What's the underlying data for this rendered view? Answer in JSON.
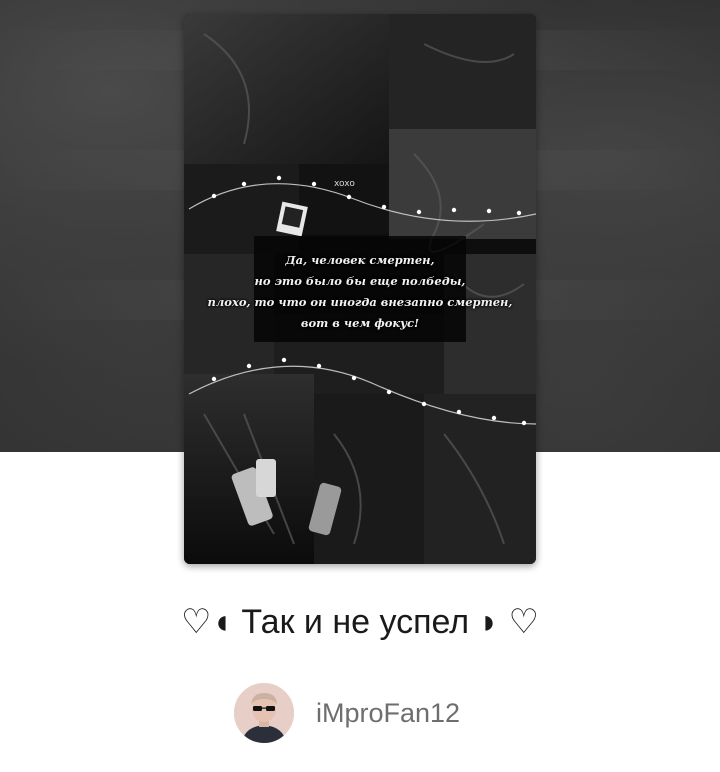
{
  "story": {
    "title": "♡◖ Так и не успел ◗ ♡",
    "cover": {
      "quote_lines": [
        "Да, человек смертен,",
        "но это было бы еще полбеды,",
        "плохо, то что он иногда внезапно смертен,",
        "вот в чем фокус!"
      ],
      "badge_text": "xoxo"
    },
    "author": {
      "username": "iMproFan12",
      "avatar_icon": "avatar-with-sunglasses"
    }
  },
  "colors": {
    "background": "#ffffff",
    "hero": "#2b2b2b",
    "title_text": "#1a1a1a",
    "author_text": "#6e6e6e",
    "avatar_bg": "#e7cfc8"
  }
}
